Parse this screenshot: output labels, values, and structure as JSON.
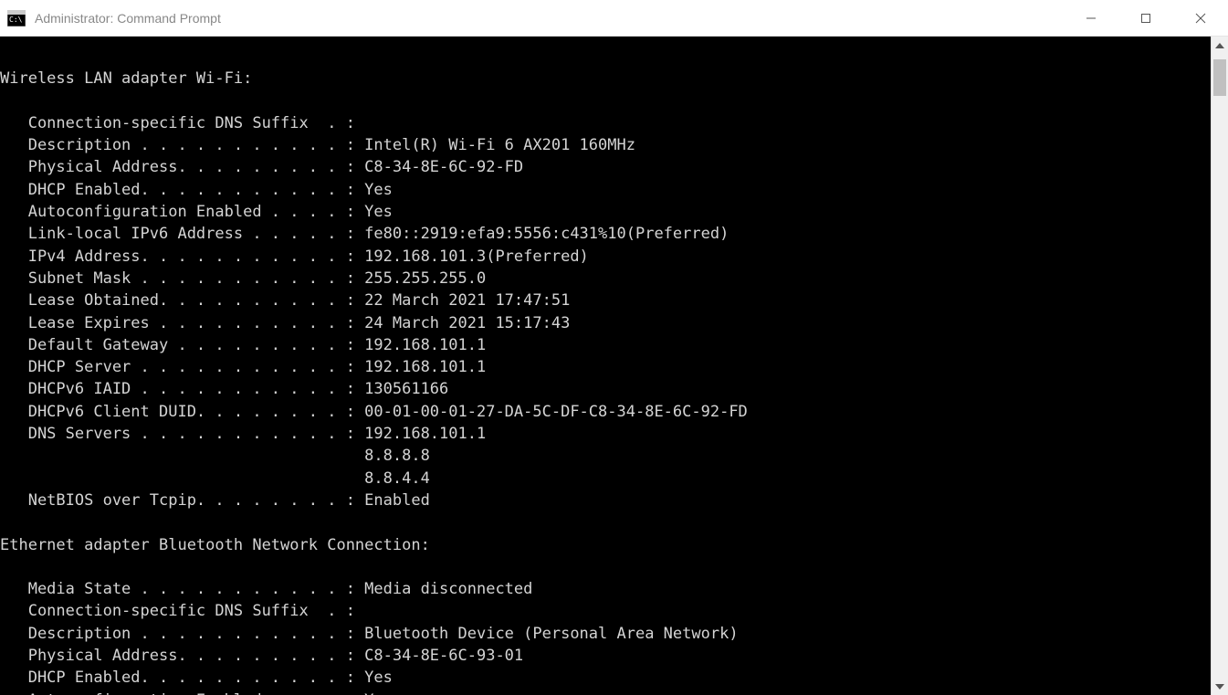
{
  "window": {
    "title": "Administrator: Command Prompt"
  },
  "terminal": {
    "sections": [
      {
        "header": "Wireless LAN adapter Wi-Fi:",
        "lines": [
          {
            "label": "Connection-specific DNS Suffix  .",
            "value": ""
          },
          {
            "label": "Description . . . . . . . . . . .",
            "value": "Intel(R) Wi-Fi 6 AX201 160MHz"
          },
          {
            "label": "Physical Address. . . . . . . . .",
            "value": "C8-34-8E-6C-92-FD"
          },
          {
            "label": "DHCP Enabled. . . . . . . . . . .",
            "value": "Yes"
          },
          {
            "label": "Autoconfiguration Enabled . . . .",
            "value": "Yes"
          },
          {
            "label": "Link-local IPv6 Address . . . . .",
            "value": "fe80::2919:efa9:5556:c431%10(Preferred)"
          },
          {
            "label": "IPv4 Address. . . . . . . . . . .",
            "value": "192.168.101.3(Preferred)"
          },
          {
            "label": "Subnet Mask . . . . . . . . . . .",
            "value": "255.255.255.0"
          },
          {
            "label": "Lease Obtained. . . . . . . . . .",
            "value": "22 March 2021 17:47:51"
          },
          {
            "label": "Lease Expires . . . . . . . . . .",
            "value": "24 March 2021 15:17:43"
          },
          {
            "label": "Default Gateway . . . . . . . . .",
            "value": "192.168.101.1"
          },
          {
            "label": "DHCP Server . . . . . . . . . . .",
            "value": "192.168.101.1"
          },
          {
            "label": "DHCPv6 IAID . . . . . . . . . . .",
            "value": "130561166"
          },
          {
            "label": "DHCPv6 Client DUID. . . . . . . .",
            "value": "00-01-00-01-27-DA-5C-DF-C8-34-8E-6C-92-FD"
          },
          {
            "label": "DNS Servers . . . . . . . . . . .",
            "value": "192.168.101.1"
          },
          {
            "label": "",
            "value": "8.8.8.8",
            "continuation": true
          },
          {
            "label": "",
            "value": "8.8.4.4",
            "continuation": true
          },
          {
            "label": "NetBIOS over Tcpip. . . . . . . .",
            "value": "Enabled"
          }
        ]
      },
      {
        "header": "Ethernet adapter Bluetooth Network Connection:",
        "lines": [
          {
            "label": "Media State . . . . . . . . . . .",
            "value": "Media disconnected"
          },
          {
            "label": "Connection-specific DNS Suffix  .",
            "value": ""
          },
          {
            "label": "Description . . . . . . . . . . .",
            "value": "Bluetooth Device (Personal Area Network)"
          },
          {
            "label": "Physical Address. . . . . . . . .",
            "value": "C8-34-8E-6C-93-01"
          },
          {
            "label": "DHCP Enabled. . . . . . . . . . .",
            "value": "Yes"
          },
          {
            "label": "Autoconfiguration Enabled . . . .",
            "value": "Yes"
          }
        ]
      }
    ],
    "indent": "   ",
    "continuation_pad": "                                       "
  }
}
